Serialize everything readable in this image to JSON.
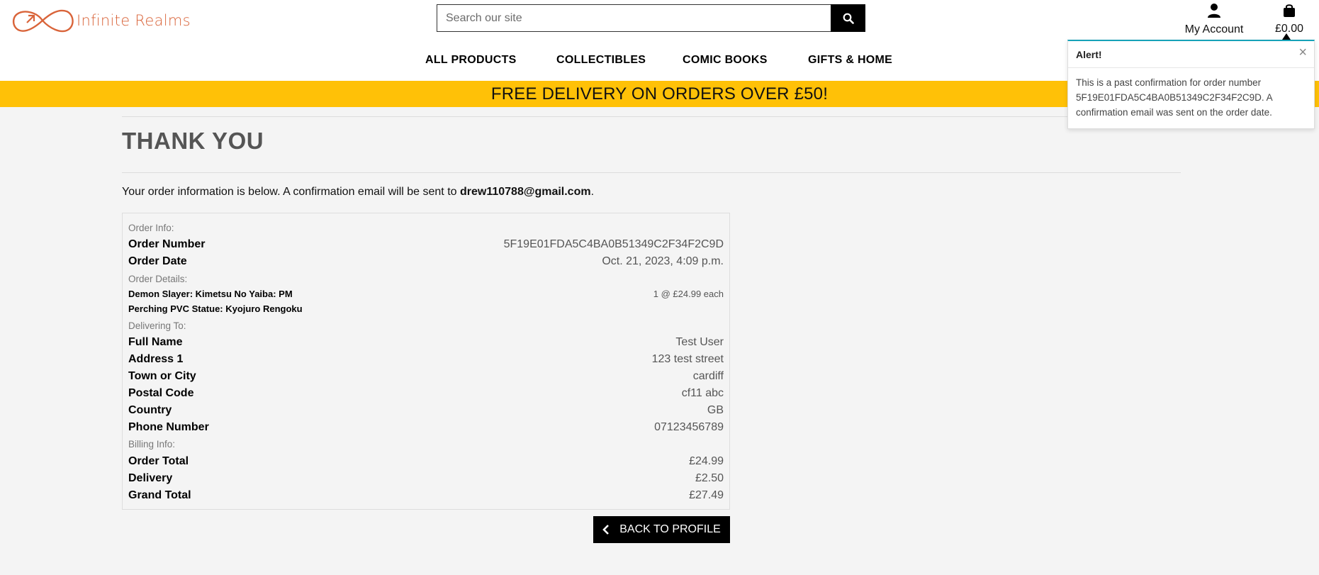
{
  "header": {
    "logo_text": "Infinite Realms",
    "search_placeholder": "Search our site",
    "account_label": "My Account",
    "bag_total": "£0.00",
    "accent_color": "#d9643a"
  },
  "nav": {
    "items": [
      "ALL PRODUCTS",
      "COLLECTIBLES",
      "COMIC BOOKS",
      "GIFTS & HOME"
    ]
  },
  "banner": {
    "text": "FREE DELIVERY ON ORDERS OVER £50!",
    "color": "#ffc107"
  },
  "main": {
    "title": "THANK YOU",
    "intro_prefix": "Your order information is below. A confirmation email will be sent to ",
    "email": "drew110788@gmail.com",
    "intro_suffix": "."
  },
  "order": {
    "order_info_heading": "Order Info:",
    "order_number_label": "Order Number",
    "order_number": "5F19E01FDA5C4BA0B51349C2F34F2C9D",
    "order_date_label": "Order Date",
    "order_date": "Oct. 21, 2023, 4:09 p.m.",
    "order_details_heading": "Order Details:",
    "item_line1": "Demon Slayer: Kimetsu No Yaiba: PM",
    "item_line2": "Perching PVC Statue: Kyojuro Rengoku",
    "item_qty": "1 @ £24.99 each",
    "delivering_heading": "Delivering To:",
    "full_name_label": "Full Name",
    "full_name": "Test User",
    "address1_label": "Address 1",
    "address1": "123 test street",
    "town_label": "Town or City",
    "town": "cardiff",
    "postal_label": "Postal Code",
    "postal": "cf11 abc",
    "country_label": "Country",
    "country": "GB",
    "phone_label": "Phone Number",
    "phone": "07123456789",
    "billing_heading": "Billing Info:",
    "order_total_label": "Order Total",
    "order_total": "£24.99",
    "delivery_label": "Delivery",
    "delivery": "£2.50",
    "grand_total_label": "Grand Total",
    "grand_total": "£27.49"
  },
  "back_button_label": "BACK TO PROFILE",
  "toast": {
    "title": "Alert!",
    "close": "×",
    "body": "This is a past confirmation for order number 5F19E01FDA5C4BA0B51349C2F34F2C9D. A confirmation email was sent on the order date.",
    "accent_color": "#17a2b8"
  }
}
